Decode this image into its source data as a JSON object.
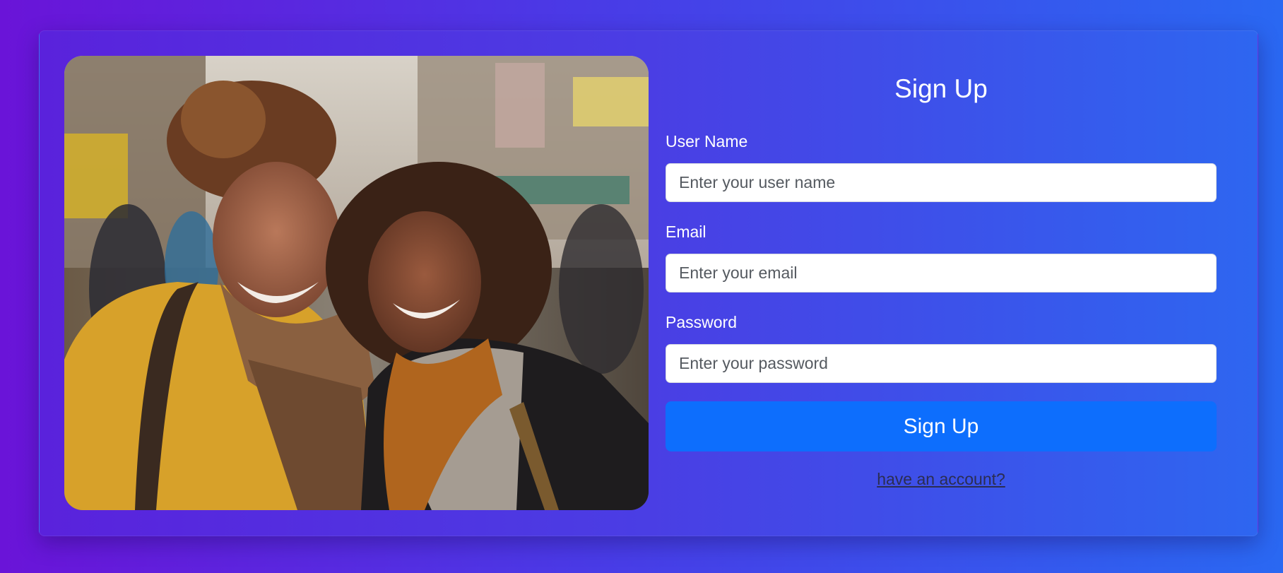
{
  "form": {
    "title": "Sign Up",
    "username_label": "User Name",
    "username_placeholder": "Enter your user name",
    "email_label": "Email",
    "email_placeholder": "Enter your email",
    "password_label": "Password",
    "password_placeholder": "Enter your password",
    "submit_label": "Sign Up",
    "account_link": "have an account?"
  },
  "colors": {
    "background_start": "#6a14d8",
    "background_end": "#2a68f2",
    "button": "#0d6efd",
    "link": "#2b2d52"
  }
}
